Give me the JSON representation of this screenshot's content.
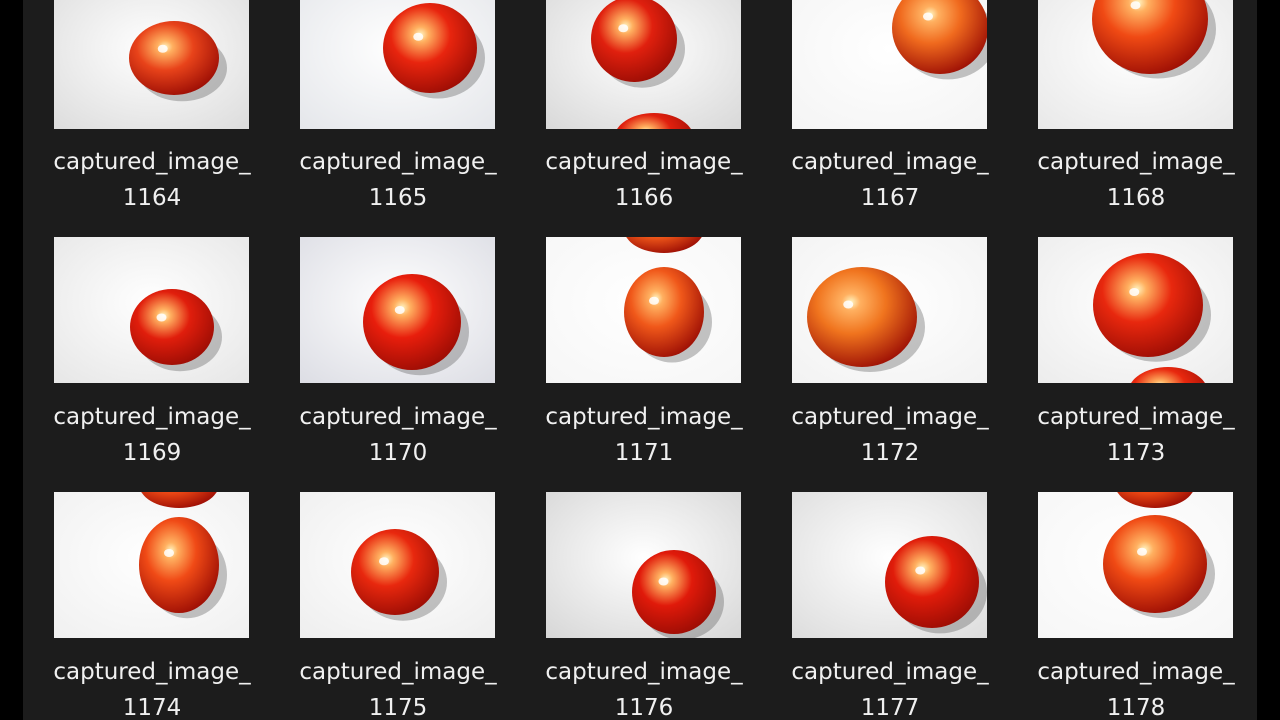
{
  "explorer": {
    "view": "large-icons",
    "items": [
      {
        "name_line1": "captured_image_",
        "name_line2": "1164",
        "bg": "#dcdcdc",
        "tomato": "#e8431a",
        "second": ""
      },
      {
        "name_line1": "captured_image_",
        "name_line2": "1165",
        "bg": "#e4e6ea",
        "tomato": "#e8250e",
        "second": ""
      },
      {
        "name_line1": "captured_image_",
        "name_line2": "1166",
        "bg": "#d8d8d8",
        "tomato": "#e0200e",
        "second": "bottom"
      },
      {
        "name_line1": "captured_image_",
        "name_line2": "1167",
        "bg": "#f4f4f4",
        "tomato": "#f06a1e",
        "second": ""
      },
      {
        "name_line1": "captured_image_",
        "name_line2": "1168",
        "bg": "#e8e8e8",
        "tomato": "#f04a14",
        "second": ""
      },
      {
        "name_line1": "captured_image_",
        "name_line2": "1169",
        "bg": "#e6e6e6",
        "tomato": "#e01e0c",
        "second": ""
      },
      {
        "name_line1": "captured_image_",
        "name_line2": "1170",
        "bg": "#dcdde4",
        "tomato": "#e81e0c",
        "second": ""
      },
      {
        "name_line1": "captured_image_",
        "name_line2": "1171",
        "bg": "#f6f6f6",
        "tomato": "#f0581a",
        "second": "top"
      },
      {
        "name_line1": "captured_image_",
        "name_line2": "1172",
        "bg": "#f2f2f2",
        "tomato": "#f0741e",
        "second": ""
      },
      {
        "name_line1": "captured_image_",
        "name_line2": "1173",
        "bg": "#ececec",
        "tomato": "#e8280e",
        "second": "bottom"
      },
      {
        "name_line1": "captured_image_",
        "name_line2": "1174",
        "bg": "#f0f0f0",
        "tomato": "#f04a16",
        "second": "top"
      },
      {
        "name_line1": "captured_image_",
        "name_line2": "1175",
        "bg": "#eeeeee",
        "tomato": "#e8280e",
        "second": ""
      },
      {
        "name_line1": "captured_image_",
        "name_line2": "1176",
        "bg": "#d6d6d6",
        "tomato": "#e01a0a",
        "second": ""
      },
      {
        "name_line1": "captured_image_",
        "name_line2": "1177",
        "bg": "#dcdcdc",
        "tomato": "#e01c0a",
        "second": ""
      },
      {
        "name_line1": "captured_image_",
        "name_line2": "1178",
        "bg": "#f6f6f6",
        "tomato": "#f04a14",
        "second": "top"
      }
    ]
  }
}
